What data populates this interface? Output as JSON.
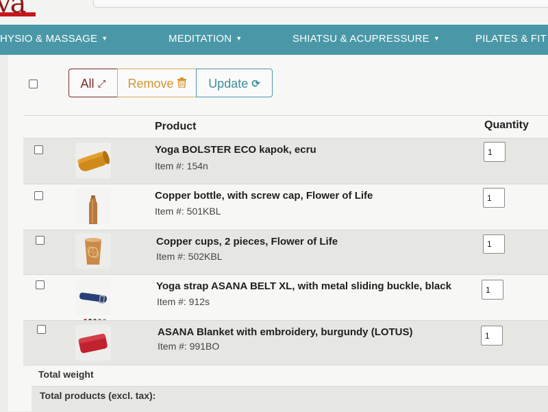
{
  "brand": {
    "logo_text": "va"
  },
  "nav": {
    "items": [
      {
        "label": "HYSIO & MASSAGE"
      },
      {
        "label": "MEDITATION"
      },
      {
        "label": "SHIATSU & ACUPRESSURE"
      },
      {
        "label": "PILATES & FIT"
      }
    ]
  },
  "toolbar": {
    "all_label": "All",
    "remove_label": "Remove",
    "update_label": "Update"
  },
  "table": {
    "headers": {
      "product": "Product",
      "quantity": "Quantity"
    },
    "rows": [
      {
        "name": "Yoga BOLSTER ECO kapok, ecru",
        "sku": "Item #: 154n",
        "qty": "1",
        "thumb_icon": "bolster-icon",
        "swatches": [
          "#7a2a2a",
          "#e07020",
          "#d8c020",
          "#4a8a3a",
          "#3a6aa0",
          "#5a3a80",
          "#222222"
        ]
      },
      {
        "name": "Copper bottle, with screw cap, Flower of Life",
        "sku": "Item #: 501KBL",
        "qty": "1",
        "thumb_icon": "copper-bottle-icon",
        "swatches": []
      },
      {
        "name": "Copper cups, 2 pieces, Flower of Life",
        "sku": "Item #: 502KBL",
        "qty": "1",
        "thumb_icon": "copper-cup-icon",
        "swatches": []
      },
      {
        "name": "Yoga strap ASANA BELT XL, with metal sliding buckle, black",
        "sku": "Item #: 912s",
        "qty": "1",
        "thumb_icon": "yoga-strap-icon",
        "swatches": [
          "#c0392b",
          "#333333",
          "#555555",
          "#777777",
          "#999999"
        ]
      },
      {
        "name": "ASANA Blanket with embroidery, burgundy (LOTUS)",
        "sku": "Item #: 991BO",
        "qty": "1",
        "thumb_icon": "blanket-icon",
        "swatches": []
      }
    ]
  },
  "footer": {
    "total_weight_label": "Total weight",
    "total_products_label": "Total products (excl. tax):"
  },
  "colors": {
    "nav_bg": "#4a98a7",
    "all_accent": "#7a2a2a",
    "remove_accent": "#d2952e",
    "update_accent": "#3f8d9c"
  }
}
